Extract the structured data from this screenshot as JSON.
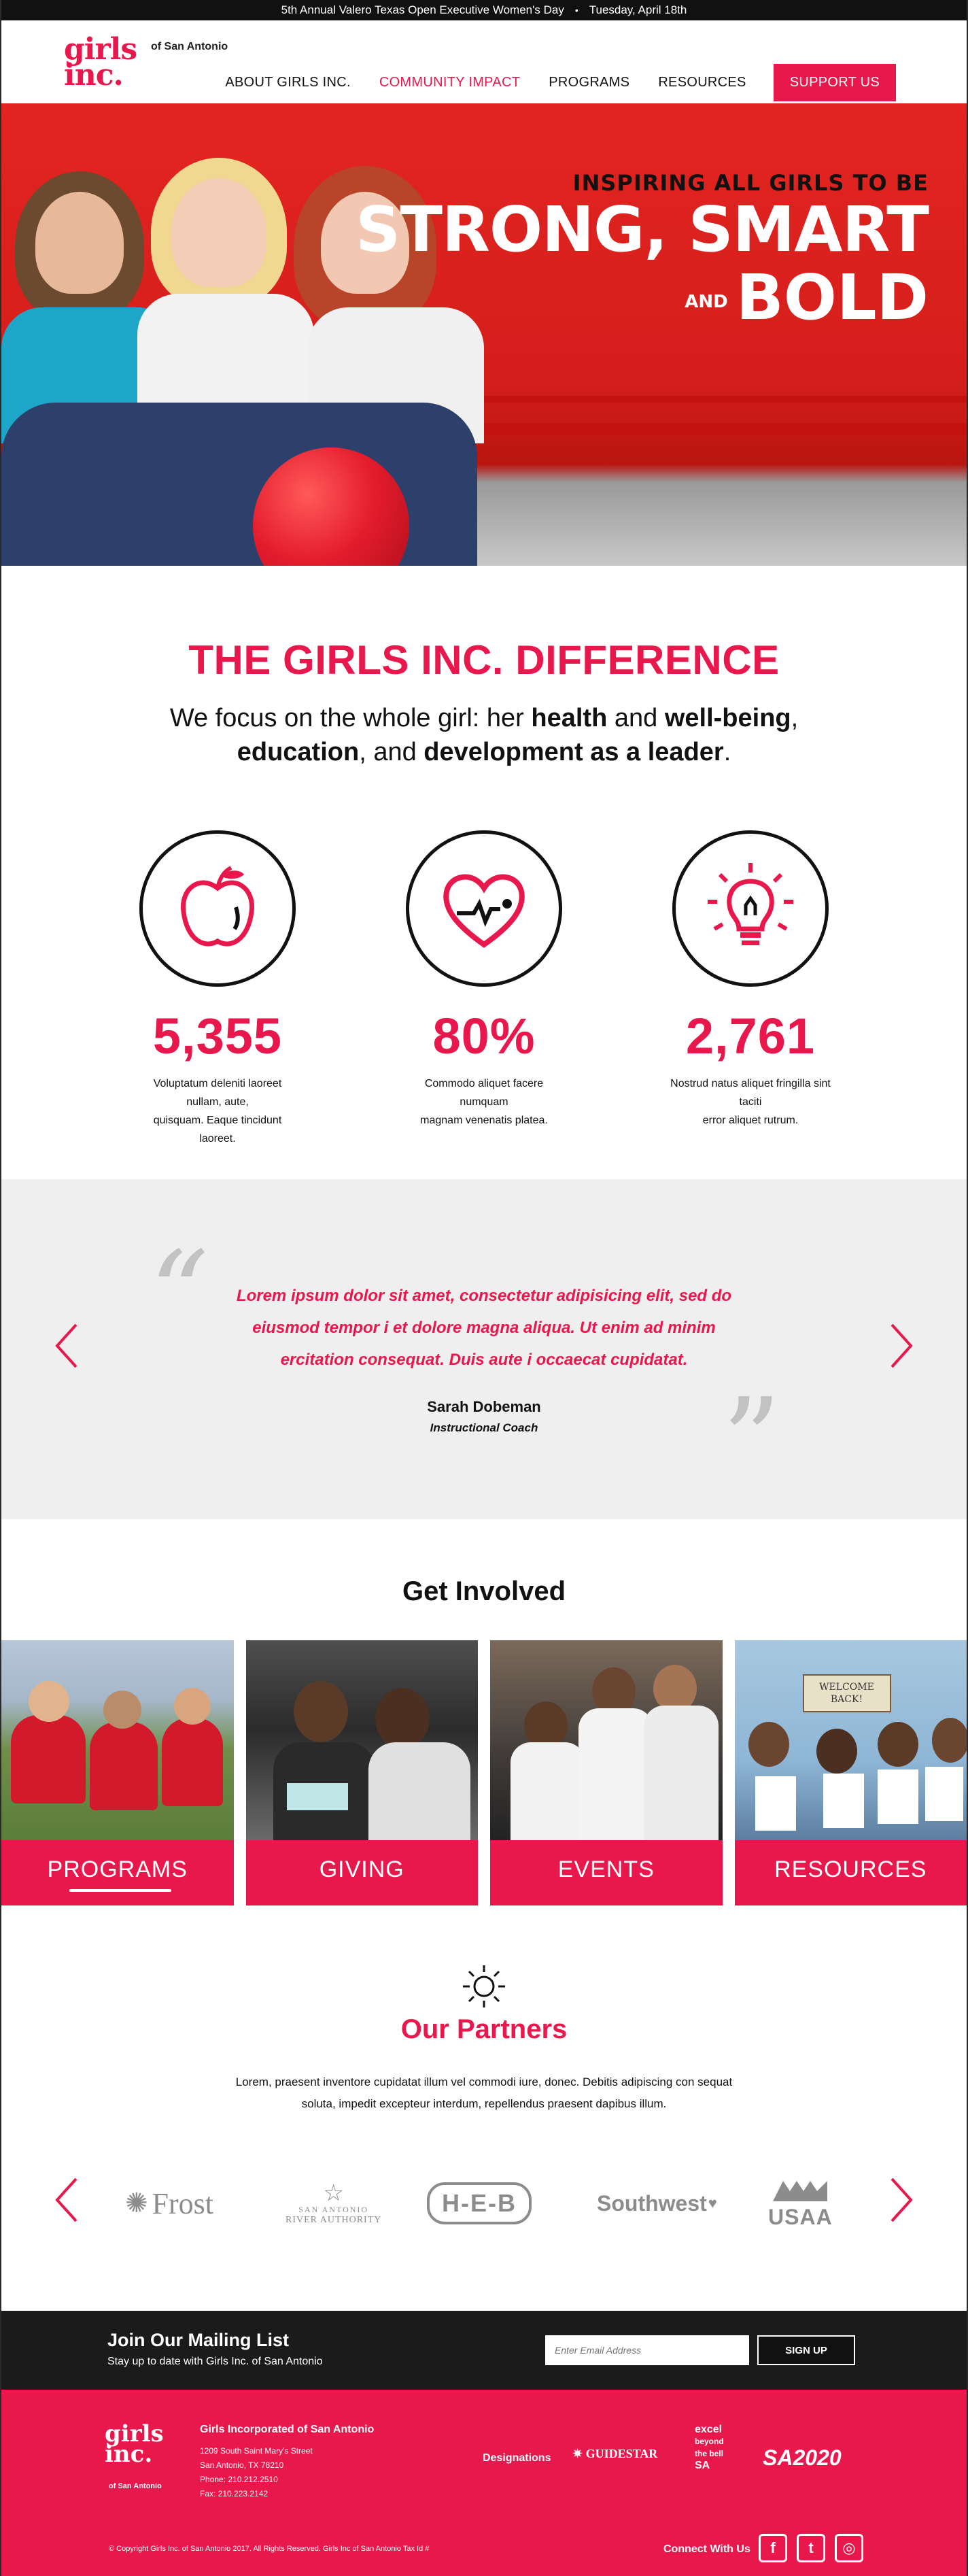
{
  "topbar": {
    "event": "5th Annual Valero Texas Open Executive Women's Day",
    "separator": "•",
    "date": "Tuesday, April 18th"
  },
  "header": {
    "logo_line1": "girls",
    "logo_line2": "inc.",
    "logo_sub": "of San Antonio",
    "nav": [
      {
        "label": "ABOUT GIRLS INC."
      },
      {
        "label": "COMMUNITY IMPACT"
      },
      {
        "label": "PROGRAMS"
      },
      {
        "label": "RESOURCES"
      }
    ],
    "support_label": "SUPPORT US"
  },
  "hero": {
    "line1": "INSPIRING ALL GIRLS TO BE",
    "line2": "STRONG, SMART",
    "and": "AND",
    "line3": "BOLD"
  },
  "difference": {
    "title": "THE GIRLS INC. DIFFERENCE",
    "lead_a": "We focus on the whole girl: her ",
    "lead_b": "health",
    "lead_c": " and ",
    "lead_d": "well-being",
    "lead_e": ",",
    "lead_f": "education",
    "lead_g": ", and ",
    "lead_h": "development as a leader",
    "lead_i": ".",
    "stats": [
      {
        "icon": "apple-icon",
        "number": "5,355",
        "text1": "Voluptatum deleniti laoreet nullam, aute,",
        "text2": "quisquam. Eaque tincidunt laoreet."
      },
      {
        "icon": "heart-icon",
        "number": "80%",
        "text1": "Commodo aliquet facere numquam",
        "text2": "magnam venenatis platea."
      },
      {
        "icon": "lightbulb-icon",
        "number": "2,761",
        "text1": "Nostrud natus aliquet fringilla sint taciti",
        "text2": "error aliquet rutrum."
      }
    ]
  },
  "testimonial": {
    "line1": "Lorem ipsum dolor sit amet, consectetur adipisicing elit, sed do",
    "line2": "eiusmod tempor i et dolore magna aliqua. Ut enim ad minim",
    "line3": "ercitation  consequat. Duis aute i occaecat cupidatat.",
    "name": "Sarah Dobeman",
    "role": "Instructional Coach"
  },
  "involved": {
    "title": "Get Involved",
    "cards": [
      {
        "label": "PROGRAMS"
      },
      {
        "label": "GIVING"
      },
      {
        "label": "EVENTS"
      },
      {
        "label": "RESOURCES"
      }
    ],
    "sign_line1": "WELCOME",
    "sign_line2": "BACK!"
  },
  "partners": {
    "title": "Our Partners",
    "text1": "Lorem, praesent inventore cupidatat illum vel commodi iure, donec. Debitis adipiscing con sequat",
    "text2": "soluta, impedit excepteur interdum, repellendus praesent dapibus illum.",
    "logos": {
      "frost": "Frost",
      "sara1": "SAN ANTONIO",
      "sara2": "RIVER AUTHORITY",
      "heb": "H-E-B",
      "southwest": "Southwest",
      "usaa": "USAA"
    }
  },
  "mailing": {
    "title": "Join Our Mailing List",
    "subtitle": "Stay up to date with Girls Inc. of San Antonio",
    "placeholder": "Enter Email Address",
    "button": "SIGN UP"
  },
  "footer": {
    "logo_line1": "girls",
    "logo_line2": "inc.",
    "logo_sub": "of San Antonio",
    "org": "Girls Incorporated of San Antonio",
    "address1": "1209 South Saint Mary's Street",
    "address2": "San Antonio, TX 78210",
    "phone": "Phone: 210.212.2510",
    "fax": "Fax: 210.223.2142",
    "designations": "Designations",
    "guidestar": "GUIDESTAR",
    "excel1": "excel",
    "excel2": "beyond",
    "excel3": "the bell",
    "excel4": "SA",
    "sa2020": "SA2020",
    "copyright": "© Copyright Girls Inc. of San Antonio 2017. All Rights Reserved. Girls Inc of San Antonio Tax Id #",
    "connect": "Connect With Us"
  },
  "colors": {
    "brand": "#e8174c",
    "dark": "#1b1b1b",
    "hero_red": "#e32521",
    "gray_band": "#efefef"
  }
}
